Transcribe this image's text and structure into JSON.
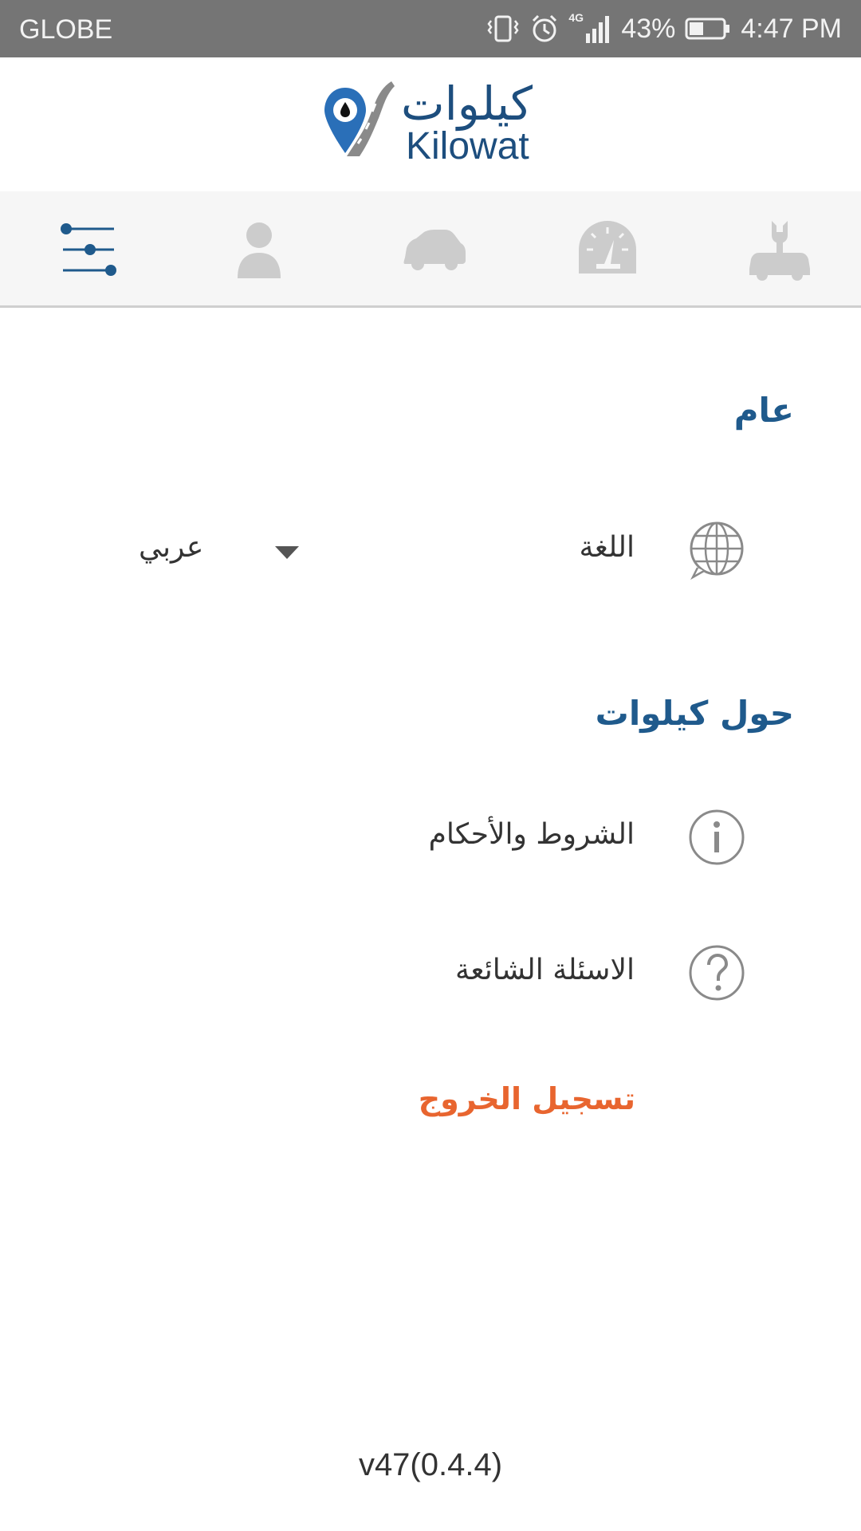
{
  "status_bar": {
    "carrier": "GLOBE",
    "network": "4G",
    "battery": "43%",
    "time": "4:47 PM",
    "battery_level": 0.43
  },
  "header": {
    "logo_arabic": "كيلوات",
    "logo_english": "Kilowat"
  },
  "tabs": [
    {
      "icon": "sliders-icon",
      "active": true
    },
    {
      "icon": "user-icon",
      "active": false
    },
    {
      "icon": "car-icon",
      "active": false
    },
    {
      "icon": "speedometer-icon",
      "active": false
    },
    {
      "icon": "car-service-icon",
      "active": false
    }
  ],
  "sections": {
    "general": {
      "title": "عام",
      "language_label": "اللغة",
      "language_value": "عربي"
    },
    "about": {
      "title": "حول كيلوات",
      "terms_label": "الشروط والأحكام",
      "faq_label": "الاسئلة الشائعة"
    }
  },
  "logout_label": "تسجيل الخروج",
  "version": "v47(0.4.4)",
  "colors": {
    "primary": "#1f5a8c",
    "accent": "#e8652f",
    "status_bar": "#757575",
    "tab_inactive": "#cccccc"
  }
}
